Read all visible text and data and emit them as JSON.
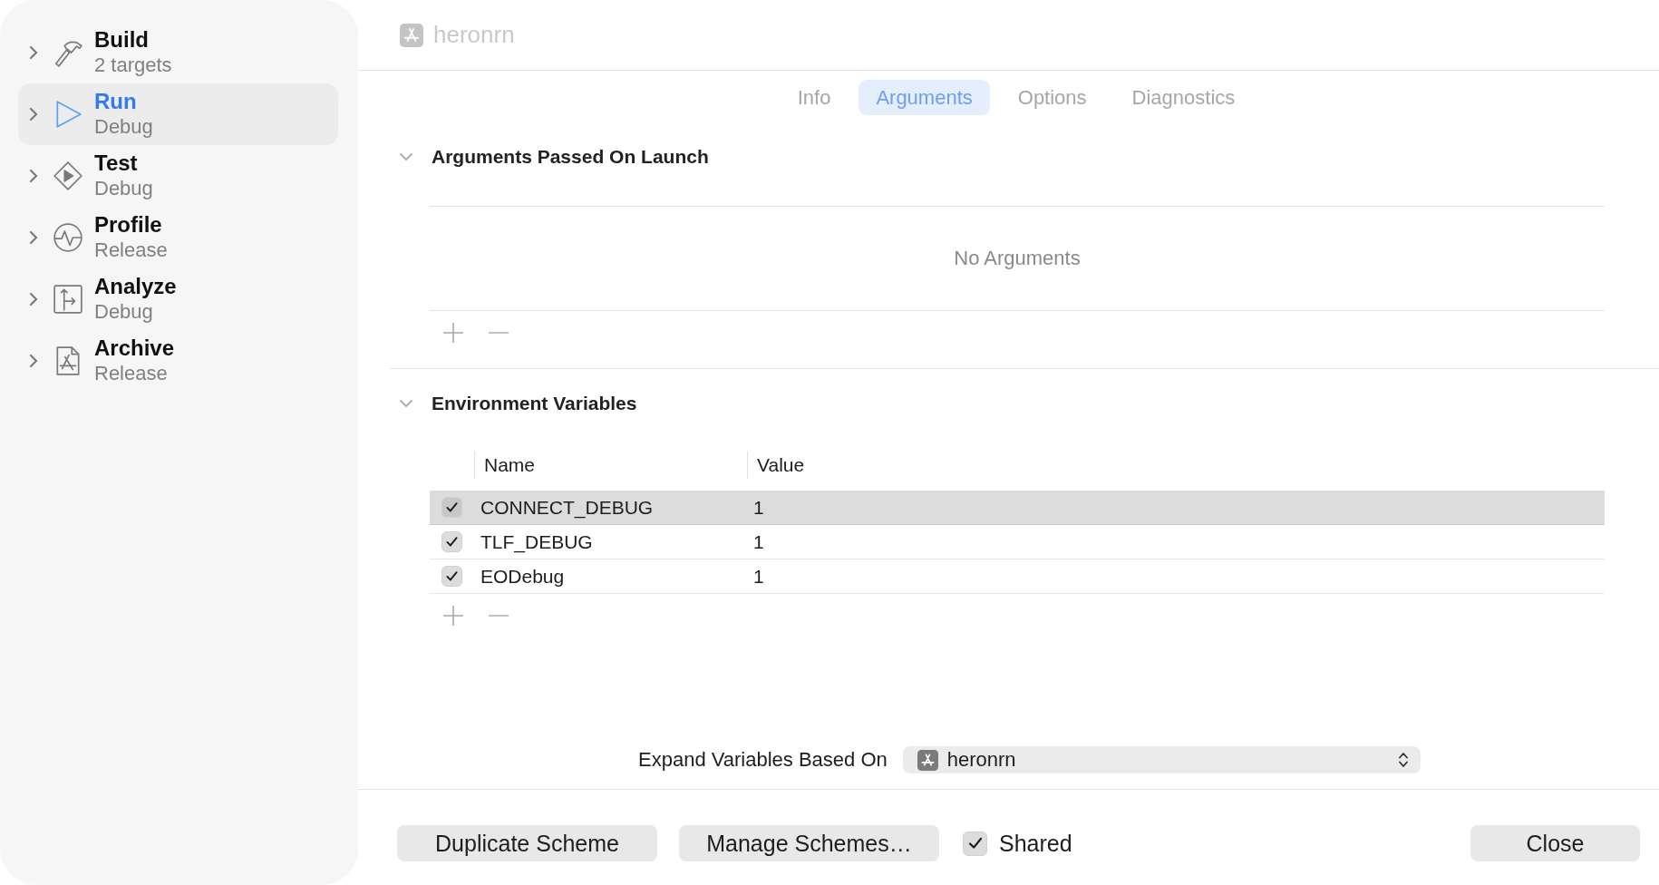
{
  "sidebar": {
    "items": [
      {
        "kind": "build",
        "title": "Build",
        "subtitle": "2 targets",
        "selected": false,
        "expanded": false
      },
      {
        "kind": "run",
        "title": "Run",
        "subtitle": "Debug",
        "selected": true,
        "expanded": false
      },
      {
        "kind": "test",
        "title": "Test",
        "subtitle": "Debug",
        "selected": false,
        "expanded": false
      },
      {
        "kind": "profile",
        "title": "Profile",
        "subtitle": "Release",
        "selected": false,
        "expanded": false
      },
      {
        "kind": "analyze",
        "title": "Analyze",
        "subtitle": "Debug",
        "selected": false,
        "expanded": false
      },
      {
        "kind": "archive",
        "title": "Archive",
        "subtitle": "Release",
        "selected": false,
        "expanded": false
      }
    ]
  },
  "header": {
    "title": "heronrn"
  },
  "tabs": [
    {
      "label": "Info",
      "selected": false
    },
    {
      "label": "Arguments",
      "selected": true
    },
    {
      "label": "Options",
      "selected": false
    },
    {
      "label": "Diagnostics",
      "selected": false
    }
  ],
  "arguments_section": {
    "title": "Arguments Passed On Launch",
    "expanded": true,
    "empty_text": "No Arguments"
  },
  "environment_section": {
    "title": "Environment Variables",
    "expanded": true,
    "columns": [
      "Name",
      "Value"
    ],
    "rows": [
      {
        "name": "CONNECT_DEBUG",
        "value": "1",
        "checked": true,
        "selected": true
      },
      {
        "name": "TLF_DEBUG",
        "value": "1",
        "checked": true,
        "selected": false
      },
      {
        "name": "EODebug",
        "value": "1",
        "checked": true,
        "selected": false
      }
    ]
  },
  "expand_variables": {
    "label": "Expand Variables Based On",
    "value": "heronrn"
  },
  "footer": {
    "buttons": [
      {
        "label": "Duplicate Scheme"
      },
      {
        "label": "Manage Schemes…"
      }
    ],
    "shared": {
      "label": "Shared",
      "checked": true
    },
    "close_button": {
      "label": "Close"
    }
  }
}
